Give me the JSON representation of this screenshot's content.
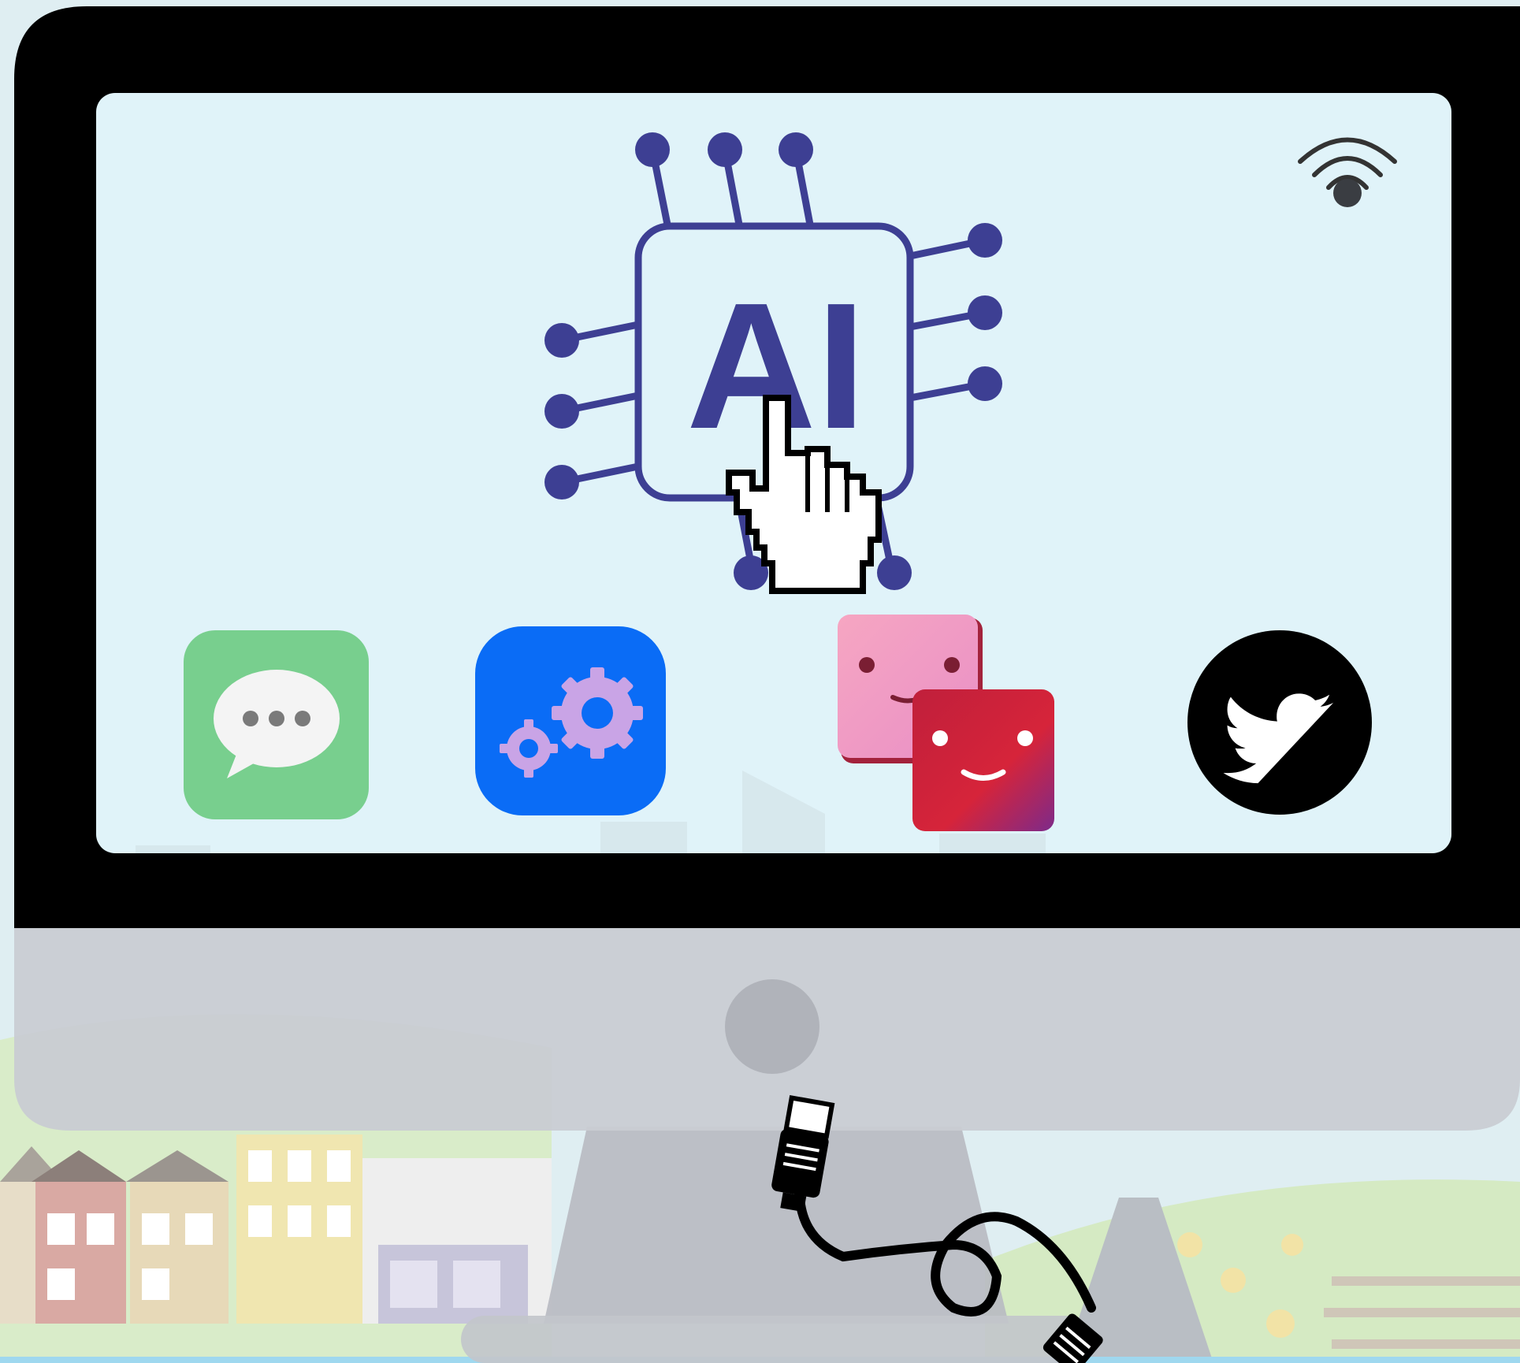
{
  "screen": {
    "ai_chip": {
      "label": "AI",
      "icon": "ai-chip-icon",
      "color": "#3d3f93"
    },
    "wifi": {
      "icon": "wifi-icon",
      "color": "#333333"
    },
    "cursor": {
      "icon": "hand-pointer-cursor-icon"
    },
    "apps": [
      {
        "icon": "messages-icon",
        "color": "#78cf8e"
      },
      {
        "icon": "settings-gears-icon",
        "color": "#0a6cf6"
      },
      {
        "icon": "friends-faces-icon",
        "color": "#d6243a"
      },
      {
        "icon": "twitter-bird-icon",
        "color": "#000000"
      }
    ]
  },
  "monitor": {
    "bezel_color": "#000000",
    "chin_color": "#c9ccd3",
    "cable": "ethernet-cable-icon"
  },
  "colors": {
    "screen_bg": "#e0f3f9",
    "sky": "#dfeef2",
    "grass": "#d9ecc9"
  }
}
